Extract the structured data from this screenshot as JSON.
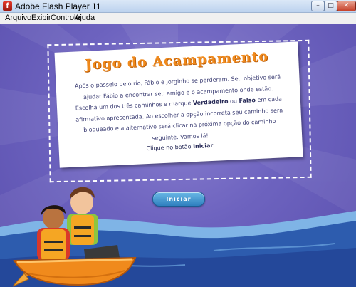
{
  "window": {
    "title": "Adobe Flash Player 11",
    "app_icon_glyph": "f",
    "controls": {
      "minimize": "–",
      "maximize": "□",
      "close": "✕"
    }
  },
  "menu": {
    "items": [
      {
        "label": "Arquivo",
        "accel": "A",
        "rest": "rquivo"
      },
      {
        "label": "Exibir",
        "accel": "E",
        "rest": "xibir"
      },
      {
        "label": "Controle",
        "accel": "C",
        "rest": "ontrole"
      },
      {
        "label": "Ajuda",
        "accel": "j",
        "pre": "A",
        "rest": "uda"
      }
    ]
  },
  "game": {
    "title": "Jogo do Acampamento",
    "intro_part1": "Após o passeio pelo rio, Fábio e Jorginho se perderam. Seu objetivo será ajudar Fábio a encontrar seu amigo e o acampamento onde estão. Escolha um dos três caminhos e marque ",
    "intro_true": "Verdadeiro",
    "intro_or": " ou ",
    "intro_false": "Falso",
    "intro_part2": " em cada afirmativo apresentada. Ao escolher a opção incorreta seu caminho será bloqueado e a alternativo será clicar na próxima opção do caminho seguinte. Vamos lá!",
    "cta_prefix": "Clique no botão ",
    "cta_bold": "Iniciar",
    "cta_suffix": ".",
    "start_button": "Iniciar"
  },
  "colors": {
    "stage_purple": "#6d63bf",
    "water_blue": "#2d5cae",
    "title_orange": "#f08a1c",
    "button_blue": "#2f7fbf"
  }
}
